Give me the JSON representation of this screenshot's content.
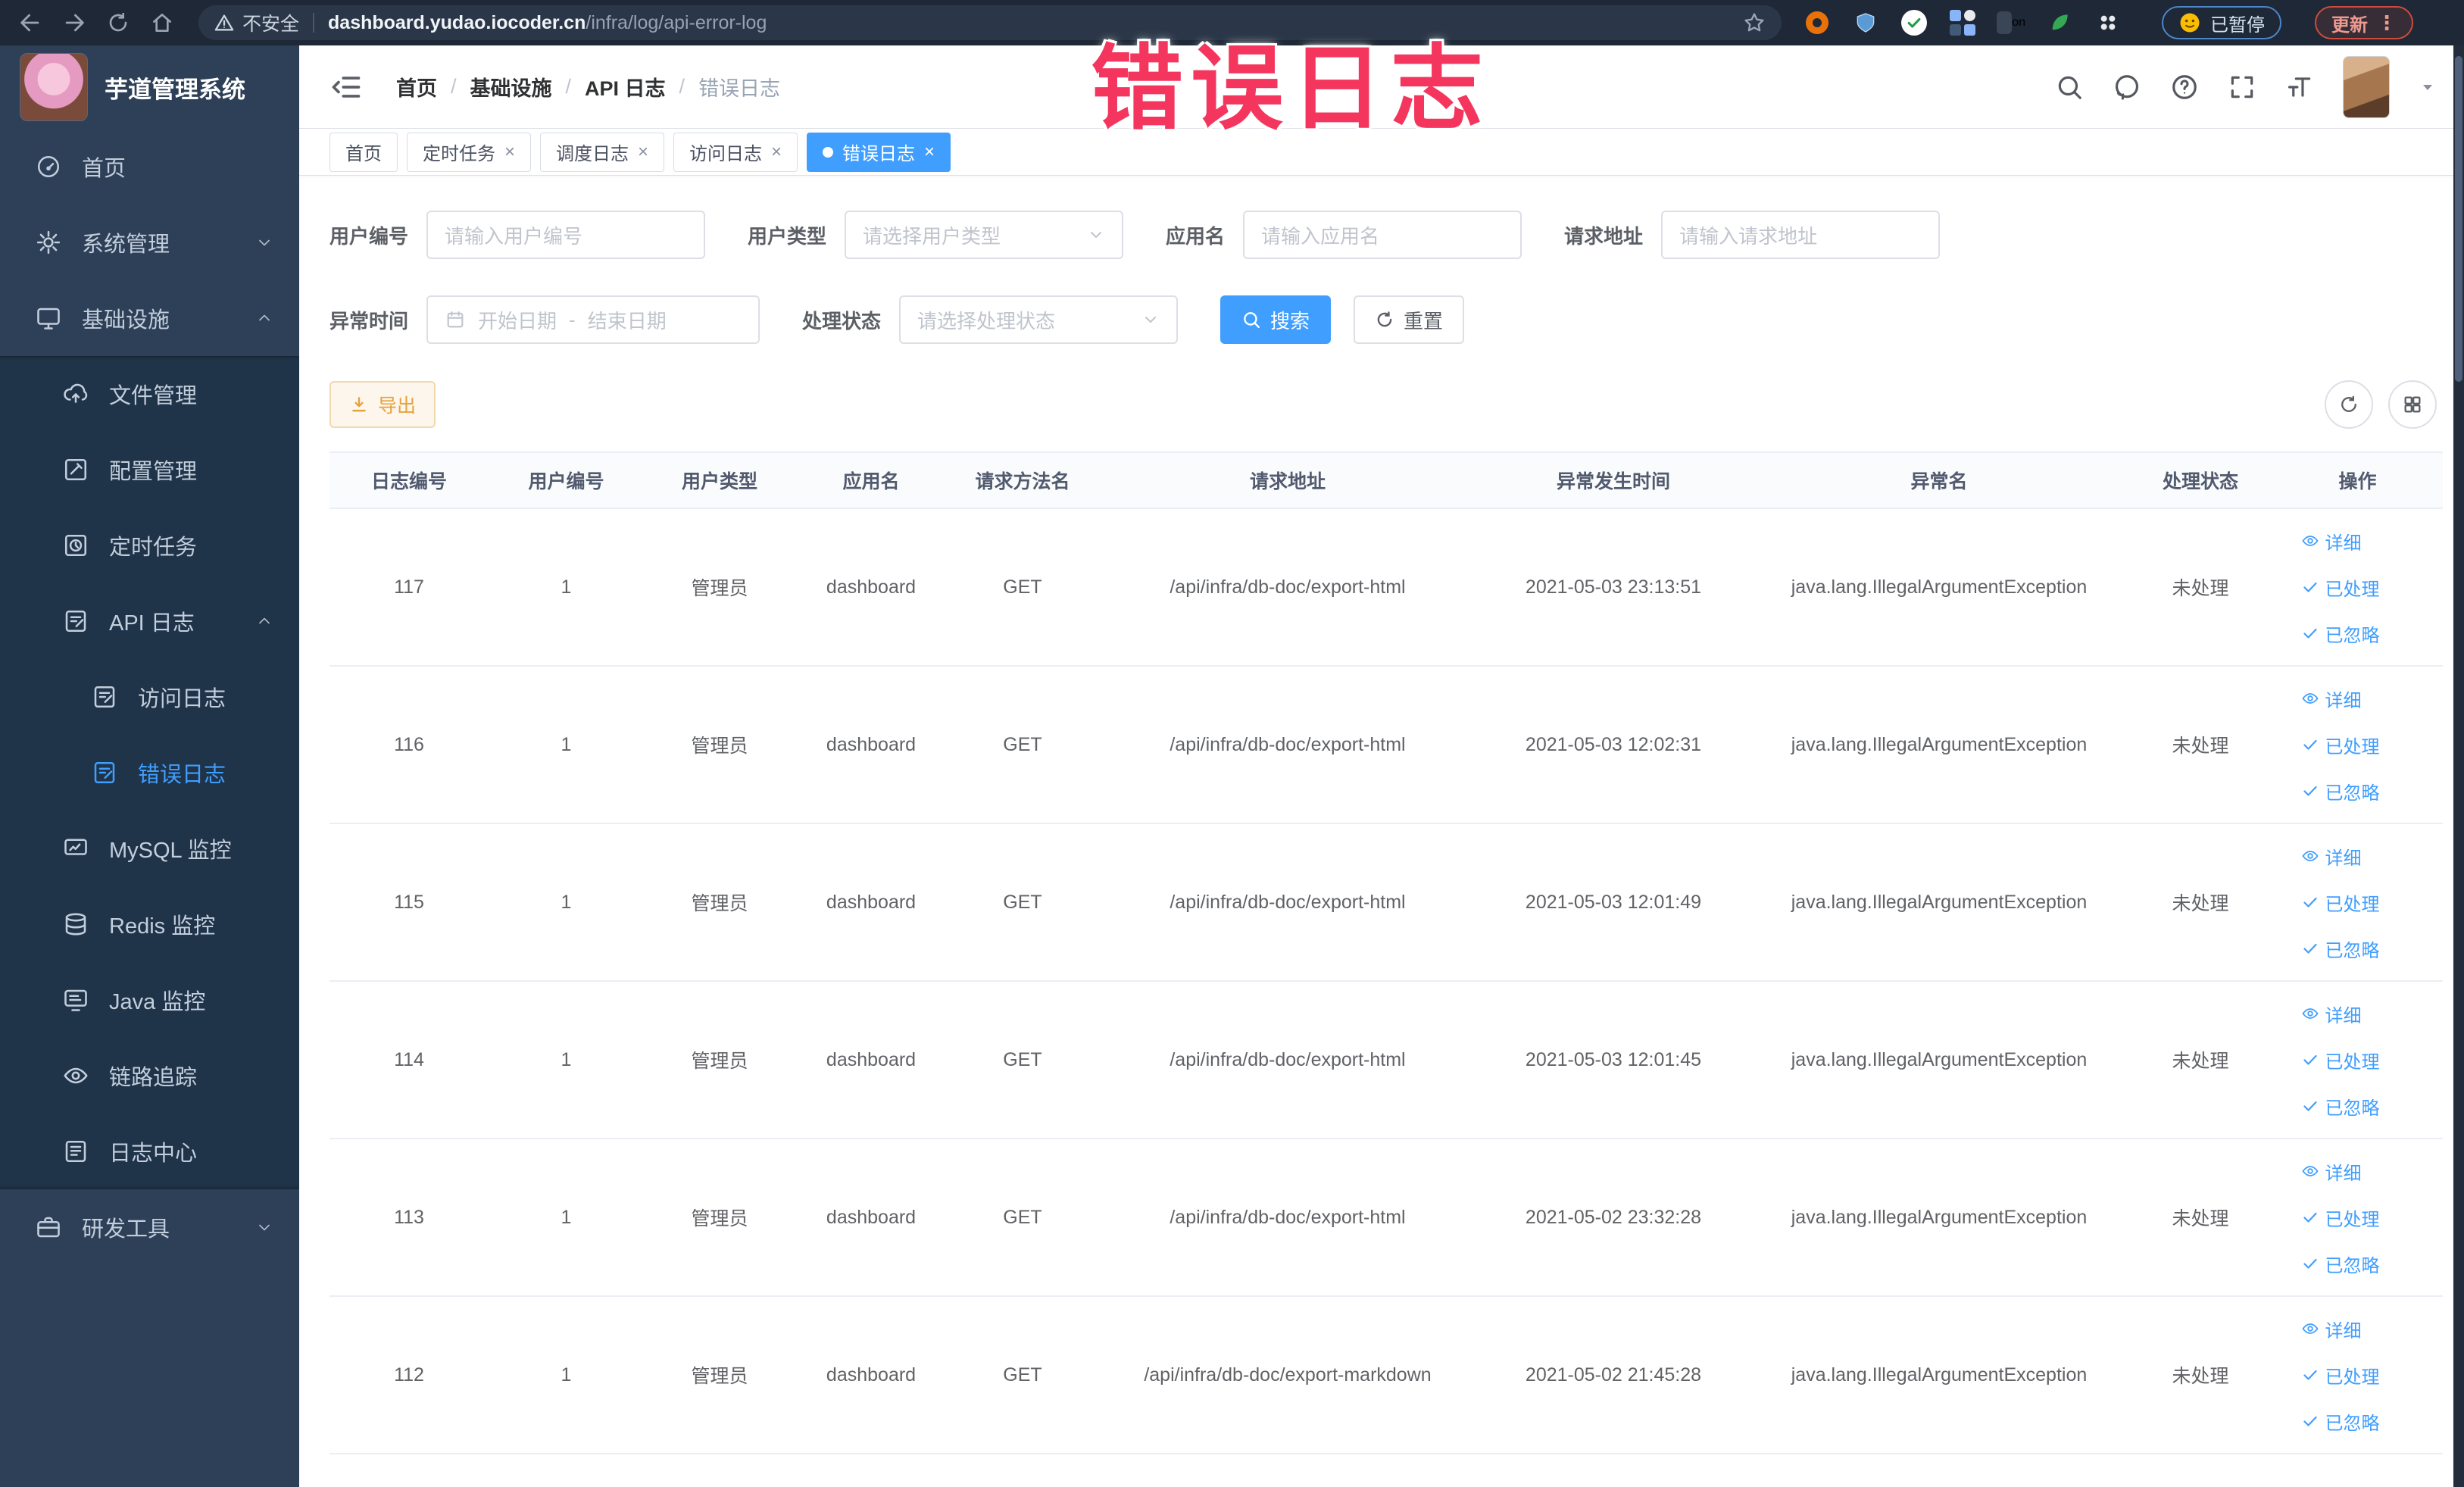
{
  "browser": {
    "warning_label": "不安全",
    "url_host": "dashboard.yudao.iocoder.cn",
    "url_path": "/infra/log/api-error-log",
    "paused_label": "已暂停",
    "update_label": "更新"
  },
  "annotation": {
    "text": "错误日志",
    "color": "#f4365e"
  },
  "sidebar": {
    "logo_title": "芋道管理系统",
    "items": [
      {
        "label": "首页",
        "icon": "dashboard-icon",
        "level": 1
      },
      {
        "label": "系统管理",
        "icon": "gear-icon",
        "level": 1,
        "chevron": "down"
      },
      {
        "label": "基础设施",
        "icon": "monitor-icon",
        "level": 1,
        "chevron": "up"
      },
      {
        "label": "文件管理",
        "icon": "cloud-upload-icon",
        "level": 2,
        "sub": true
      },
      {
        "label": "配置管理",
        "icon": "edit-square-icon",
        "level": 2,
        "sub": true
      },
      {
        "label": "定时任务",
        "icon": "timer-icon",
        "level": 2,
        "sub": true
      },
      {
        "label": "API 日志",
        "icon": "log-doc-icon",
        "level": 2,
        "sub": true,
        "chevron": "up"
      },
      {
        "label": "访问日志",
        "icon": "log-doc-icon",
        "level": 3,
        "sub": true
      },
      {
        "label": "错误日志",
        "icon": "log-doc-icon",
        "level": 3,
        "sub": true,
        "active": true
      },
      {
        "label": "MySQL 监控",
        "icon": "mysql-icon",
        "level": 2,
        "sub": true
      },
      {
        "label": "Redis 监控",
        "icon": "redis-icon",
        "level": 2,
        "sub": true
      },
      {
        "label": "Java 监控",
        "icon": "java-monitor-icon",
        "level": 2,
        "sub": true
      },
      {
        "label": "链路追踪",
        "icon": "trace-eye-icon",
        "level": 2,
        "sub": true
      },
      {
        "label": "日志中心",
        "icon": "log-center-icon",
        "level": 2,
        "sub": true
      },
      {
        "label": "研发工具",
        "icon": "briefcase-icon",
        "level": 1,
        "chevron": "down"
      }
    ]
  },
  "header": {
    "breadcrumb": [
      "首页",
      "基础设施",
      "API 日志",
      "错误日志"
    ]
  },
  "tabs": [
    {
      "label": "首页",
      "closable": false,
      "active": false
    },
    {
      "label": "定时任务",
      "closable": true,
      "active": false
    },
    {
      "label": "调度日志",
      "closable": true,
      "active": false
    },
    {
      "label": "访问日志",
      "closable": true,
      "active": false
    },
    {
      "label": "错误日志",
      "closable": true,
      "active": true
    }
  ],
  "filters": {
    "user_id_label": "用户编号",
    "user_id_placeholder": "请输入用户编号",
    "user_type_label": "用户类型",
    "user_type_placeholder": "请选择用户类型",
    "app_name_label": "应用名",
    "app_name_placeholder": "请输入应用名",
    "request_url_label": "请求地址",
    "request_url_placeholder": "请输入请求地址",
    "exception_time_label": "异常时间",
    "start_placeholder": "开始日期",
    "range_separator": "-",
    "end_placeholder": "结束日期",
    "process_status_label": "处理状态",
    "process_status_placeholder": "请选择处理状态",
    "search_label": "搜索",
    "reset_label": "重置"
  },
  "toolbar": {
    "export_label": "导出"
  },
  "table": {
    "columns": [
      "日志编号",
      "用户编号",
      "用户类型",
      "应用名",
      "请求方法名",
      "请求地址",
      "异常发生时间",
      "异常名",
      "处理状态",
      "操作"
    ],
    "actions": [
      "详细",
      "已处理",
      "已忽略"
    ],
    "rows": [
      {
        "id": "117",
        "user_id": "1",
        "user_type": "管理员",
        "app": "dashboard",
        "method": "GET",
        "url": "/api/infra/db-doc/export-html",
        "time": "2021-05-03 23:13:51",
        "exception": "java.lang.IllegalArgumentException",
        "status": "未处理"
      },
      {
        "id": "116",
        "user_id": "1",
        "user_type": "管理员",
        "app": "dashboard",
        "method": "GET",
        "url": "/api/infra/db-doc/export-html",
        "time": "2021-05-03 12:02:31",
        "exception": "java.lang.IllegalArgumentException",
        "status": "未处理"
      },
      {
        "id": "115",
        "user_id": "1",
        "user_type": "管理员",
        "app": "dashboard",
        "method": "GET",
        "url": "/api/infra/db-doc/export-html",
        "time": "2021-05-03 12:01:49",
        "exception": "java.lang.IllegalArgumentException",
        "status": "未处理"
      },
      {
        "id": "114",
        "user_id": "1",
        "user_type": "管理员",
        "app": "dashboard",
        "method": "GET",
        "url": "/api/infra/db-doc/export-html",
        "time": "2021-05-03 12:01:45",
        "exception": "java.lang.IllegalArgumentException",
        "status": "未处理"
      },
      {
        "id": "113",
        "user_id": "1",
        "user_type": "管理员",
        "app": "dashboard",
        "method": "GET",
        "url": "/api/infra/db-doc/export-html",
        "time": "2021-05-02 23:32:28",
        "exception": "java.lang.IllegalArgumentException",
        "status": "未处理"
      },
      {
        "id": "112",
        "user_id": "1",
        "user_type": "管理员",
        "app": "dashboard",
        "method": "GET",
        "url": "/api/infra/db-doc/export-markdown",
        "time": "2021-05-02 21:45:28",
        "exception": "java.lang.IllegalArgumentException",
        "status": "未处理"
      }
    ]
  },
  "colors": {
    "accent": "#409eff",
    "warning": "#e6a23c",
    "annotation": "#f4365e",
    "sidebar_bg": "#2d4057",
    "submenu_bg": "#1f3349"
  }
}
